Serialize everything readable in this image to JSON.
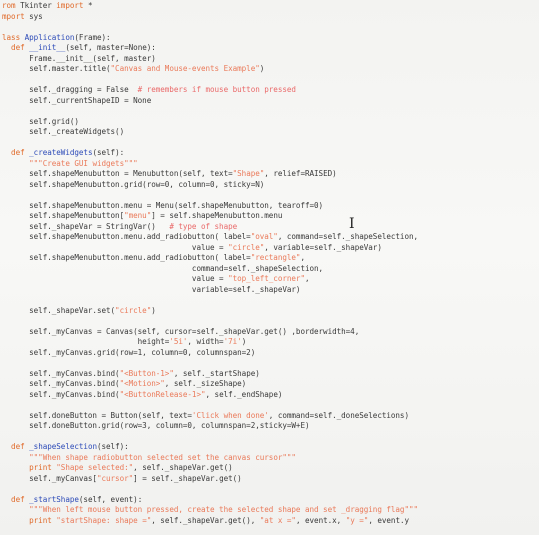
{
  "editor": {
    "lines": [
      [
        [
          "kw",
          "rom"
        ],
        [
          "pl",
          " Tkinter "
        ],
        [
          "kw",
          "import"
        ],
        [
          "pl",
          " *"
        ]
      ],
      [
        [
          "kw",
          "mport"
        ],
        [
          "pl",
          " sys"
        ]
      ],
      [],
      [
        [
          "kw",
          "lass"
        ],
        [
          "pl",
          " "
        ],
        [
          "fn",
          "Application"
        ],
        [
          "pl",
          "(Frame):"
        ]
      ],
      [
        [
          "pl",
          "  "
        ],
        [
          "kw",
          "def"
        ],
        [
          "pl",
          " "
        ],
        [
          "fn",
          "__init__"
        ],
        [
          "pl",
          "(self, master=None):"
        ]
      ],
      [
        [
          "pl",
          "      Frame.__init__(self, master)"
        ]
      ],
      [
        [
          "pl",
          "      self.master.title("
        ],
        [
          "st",
          "\"Canvas and Mouse-events Example\""
        ],
        [
          "pl",
          ")"
        ]
      ],
      [],
      [
        [
          "pl",
          "      self._dragging = False  "
        ],
        [
          "cm",
          "# remembers if mouse button pressed"
        ]
      ],
      [
        [
          "pl",
          "      self._currentShapeID = None"
        ]
      ],
      [],
      [
        [
          "pl",
          "      self.grid()"
        ]
      ],
      [
        [
          "pl",
          "      self._createWidgets()"
        ]
      ],
      [],
      [
        [
          "pl",
          "  "
        ],
        [
          "kw",
          "def"
        ],
        [
          "pl",
          " "
        ],
        [
          "fn",
          "_createWidgets"
        ],
        [
          "pl",
          "(self):"
        ]
      ],
      [
        [
          "pl",
          "      "
        ],
        [
          "st",
          "\"\"\"Create GUI widgets\"\"\""
        ]
      ],
      [
        [
          "pl",
          "      self.shapeMenubutton = Menubutton(self, text="
        ],
        [
          "st",
          "\"Shape\""
        ],
        [
          "pl",
          ", relief=RAISED)"
        ]
      ],
      [
        [
          "pl",
          "      self.shapeMenubutton.grid(row=0, column=0, sticky=N)"
        ]
      ],
      [],
      [
        [
          "pl",
          "      self.shapeMenubutton.menu = Menu(self.shapeMenubutton, tearoff=0)"
        ]
      ],
      [
        [
          "pl",
          "      self.shapeMenubutton["
        ],
        [
          "st",
          "\"menu\""
        ],
        [
          "pl",
          "] = self.shapeMenubutton.menu"
        ]
      ],
      [
        [
          "pl",
          "      self._shapeVar = StringVar()   "
        ],
        [
          "cm",
          "# type of shape"
        ]
      ],
      [
        [
          "pl",
          "      self.shapeMenubutton.menu.add_radiobutton( label="
        ],
        [
          "st",
          "\"oval\""
        ],
        [
          "pl",
          ", command=self._shapeSelection,"
        ]
      ],
      [
        [
          "pl",
          "                                          value = "
        ],
        [
          "st",
          "\"circle\""
        ],
        [
          "pl",
          ", variable=self._shapeVar)"
        ]
      ],
      [
        [
          "pl",
          "      self.shapeMenubutton.menu.add_radiobutton( label="
        ],
        [
          "st",
          "\"rectangle\""
        ],
        [
          "pl",
          ","
        ]
      ],
      [
        [
          "pl",
          "                                          command=self._shapeSelection,"
        ]
      ],
      [
        [
          "pl",
          "                                          value = "
        ],
        [
          "st",
          "\"top_left_corner\""
        ],
        [
          "pl",
          ","
        ]
      ],
      [
        [
          "pl",
          "                                          variable=self._shapeVar)"
        ]
      ],
      [],
      [
        [
          "pl",
          "      self._shapeVar.set("
        ],
        [
          "st",
          "\"circle\""
        ],
        [
          "pl",
          ")"
        ]
      ],
      [],
      [
        [
          "pl",
          "      self._myCanvas = Canvas(self, cursor=self._shapeVar.get() ,borderwidth=4,"
        ]
      ],
      [
        [
          "pl",
          "                              height="
        ],
        [
          "st",
          "'5i'"
        ],
        [
          "pl",
          ", width="
        ],
        [
          "st",
          "'7i'"
        ],
        [
          "pl",
          ")"
        ]
      ],
      [
        [
          "pl",
          "      self._myCanvas.grid(row=1, column=0, columnspan=2)"
        ]
      ],
      [],
      [
        [
          "pl",
          "      self._myCanvas.bind("
        ],
        [
          "st",
          "\"<Button-1>\""
        ],
        [
          "pl",
          ", self._startShape)"
        ]
      ],
      [
        [
          "pl",
          "      self._myCanvas.bind("
        ],
        [
          "st",
          "\"<Motion>\""
        ],
        [
          "pl",
          ", self._sizeShape)"
        ]
      ],
      [
        [
          "pl",
          "      self._myCanvas.bind("
        ],
        [
          "st",
          "\"<ButtonRelease-1>\""
        ],
        [
          "pl",
          ", self._endShape)"
        ]
      ],
      [],
      [
        [
          "pl",
          "      self.doneButton = Button(self, text="
        ],
        [
          "st",
          "'Click when done'"
        ],
        [
          "pl",
          ", command=self._doneSelections)"
        ]
      ],
      [
        [
          "pl",
          "      self.doneButton.grid(row=3, column=0, columnspan=2,sticky=W+E)"
        ]
      ],
      [],
      [
        [
          "pl",
          "  "
        ],
        [
          "kw",
          "def"
        ],
        [
          "pl",
          " "
        ],
        [
          "fn",
          "_shapeSelection"
        ],
        [
          "pl",
          "(self):"
        ]
      ],
      [
        [
          "pl",
          "      "
        ],
        [
          "st",
          "\"\"\"When shape radiobutton selected set the canvas cursor\"\"\""
        ]
      ],
      [
        [
          "pl",
          "      "
        ],
        [
          "kw",
          "print"
        ],
        [
          "pl",
          " "
        ],
        [
          "st",
          "\"Shape selected:\""
        ],
        [
          "pl",
          ", self._shapeVar.get()"
        ]
      ],
      [
        [
          "pl",
          "      self._myCanvas["
        ],
        [
          "st",
          "\"cursor\""
        ],
        [
          "pl",
          "] = self._shapeVar.get()"
        ]
      ],
      [],
      [
        [
          "pl",
          "  "
        ],
        [
          "kw",
          "def"
        ],
        [
          "pl",
          " "
        ],
        [
          "fn",
          "_startShape"
        ],
        [
          "pl",
          "(self, event):"
        ]
      ],
      [
        [
          "pl",
          "      "
        ],
        [
          "st",
          "\"\"\"When left mouse button pressed, create the selected shape and set _dragging flag\"\"\""
        ]
      ],
      [
        [
          "pl",
          "      "
        ],
        [
          "kw",
          "print"
        ],
        [
          "pl",
          " "
        ],
        [
          "st",
          "\"startShape: shape =\""
        ],
        [
          "pl",
          ", self._shapeVar.get(), "
        ],
        [
          "st",
          "\"at x =\""
        ],
        [
          "pl",
          ", event.x, "
        ],
        [
          "st",
          "\"y =\""
        ],
        [
          "pl",
          ", event.y"
        ]
      ]
    ],
    "cursor_glyph": "I"
  }
}
